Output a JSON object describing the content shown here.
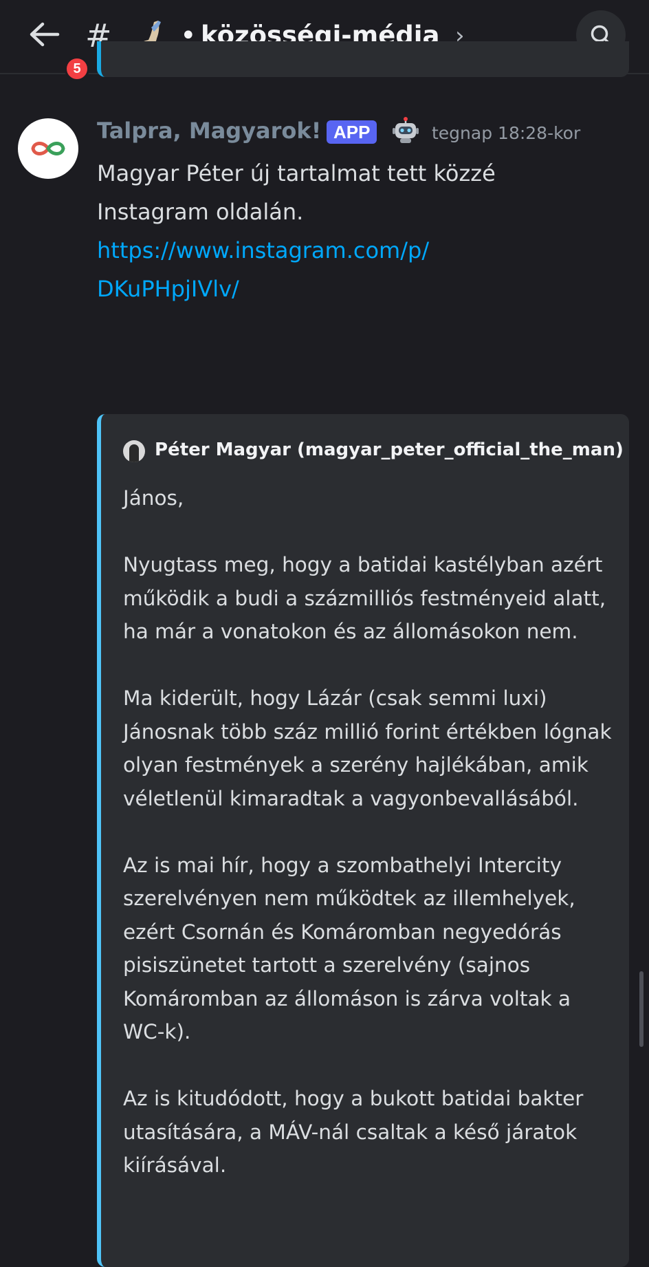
{
  "header": {
    "unread_badge": "5",
    "hash_symbol": "#",
    "dot": "•",
    "channel_name": "közösségi-média",
    "chevron": "›",
    "icons": {
      "back": "arrow-left-icon",
      "search": "search-icon",
      "channel_emoji": "flexed-biceps-icon"
    }
  },
  "message": {
    "author": "Talpra, Magyarok!",
    "app_tag": "APP",
    "timestamp": "tegnap 18:28-kor",
    "text": "Magyar Péter új tartalmat tett közzé Instagram oldalán.",
    "link": "https://www.instagram.com/p/DKuPHpjIVlv/",
    "link_line1": "https://www.instagram.com/p/",
    "link_line2": "DKuPHpjIVlv/",
    "embed": {
      "author": "Péter Magyar (magyar_peter_official_the_man)",
      "paragraphs": [
        "János,",
        "Nyugtass meg, hogy a batidai kastélyban azért működik a budi a százmilliós festményeid alatt, ha már a vonatokon és az állomásokon nem.",
        "Ma kiderült, hogy Lázár (csak semmi luxi) Jánosnak több száz millió forint értékben lógnak olyan festmények a szerény hajlékában, amik véletlenül kimaradtak a vagyonbevallásából.",
        "Az is mai hír, hogy a szombathelyi Intercity szerelvényen nem működtek az illemhelyek, ezért Csornán és Komáromban negyedórás pisiszünetet tartott a szerelvény (sajnos Komáromban az állomáson is zárva voltak a WC-k).",
        "Az is kitudódott, hogy a bukott batidai bakter utasítására, a MÁV-nál csaltak a késő járatok kiírásával."
      ]
    }
  },
  "colors": {
    "background": "#1c1c21",
    "embed_bg": "#2b2d31",
    "embed_accent": "#4fc3f7",
    "link": "#00a8fc",
    "app_tag": "#5865f2",
    "badge": "#f23f43"
  }
}
